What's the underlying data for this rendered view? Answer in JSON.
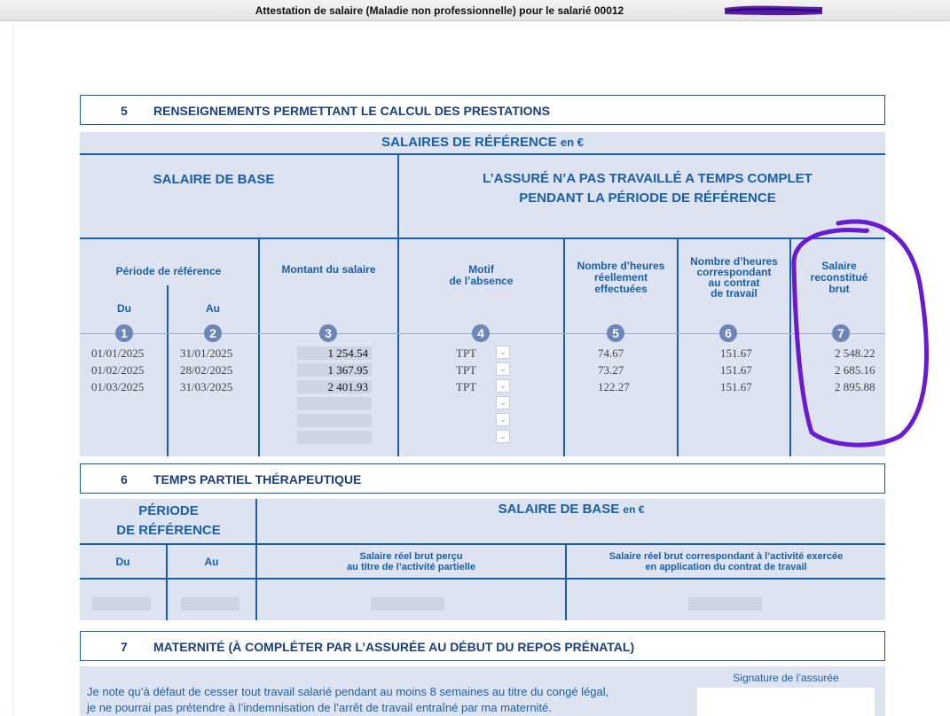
{
  "window": {
    "title": "Attestation de salaire (Maladie non professionnelle) pour le salarié 00012"
  },
  "section5": {
    "number": "5",
    "title": "RENSEIGNEMENTS PERMETTANT LE CALCUL DES PRESTATIONS",
    "ref_title": "SALAIRES DE RÉFÉRENCE",
    "ref_unit": "en €",
    "base_title": "SALAIRE DE BASE",
    "partial_title_1": "L’ASSURÉ N’A PAS TRAVAILLÉ A TEMPS COMPLET",
    "partial_title_2": "PENDANT LA PÉRIODE DE RÉFÉRENCE",
    "col_period": "Période de référence",
    "col_from": "Du",
    "col_to": "Au",
    "col_amount": "Montant du salaire",
    "col_reason_1": "Motif",
    "col_reason_2": "de l’absence",
    "col_hours_1": "Nombre d’heures",
    "col_hours_2": "réellement",
    "col_hours_3": "effectuées",
    "col_contract_1": "Nombre d’heures",
    "col_contract_2": "correspondant",
    "col_contract_3": "au contrat",
    "col_contract_4": "de travail",
    "col_recon_1": "Salaire",
    "col_recon_2": "reconstitué",
    "col_recon_3": "brut",
    "markers": [
      "1",
      "2",
      "3",
      "4",
      "5",
      "6",
      "7"
    ],
    "rows": [
      {
        "from": "01/01/2025",
        "to": "31/01/2025",
        "amount": "1 254.54",
        "reason": "TPT",
        "hours": "74.67",
        "contract": "151.67",
        "recon": "2 548.22"
      },
      {
        "from": "01/02/2025",
        "to": "28/02/2025",
        "amount": "1 367.95",
        "reason": "TPT",
        "hours": "73.27",
        "contract": "151.67",
        "recon": "2 685.16"
      },
      {
        "from": "01/03/2025",
        "to": "31/03/2025",
        "amount": "2 401.93",
        "reason": "TPT",
        "hours": "122.27",
        "contract": "151.67",
        "recon": "2 895.88"
      }
    ]
  },
  "section6": {
    "number": "6",
    "title": "TEMPS PARTIEL THÉRAPEUTIQUE",
    "period_1": "PÉRIODE",
    "period_2": "DE RÉFÉRENCE",
    "base_title": "SALAIRE DE BASE",
    "base_unit": "en €",
    "col_from": "Du",
    "col_to": "Au",
    "col_real_1": "Salaire réel brut perçu",
    "col_real_2": "au titre de l’activité partielle",
    "col_contract_1": "Salaire réel brut correspondant à l’activité exercée",
    "col_contract_2": "en application du contrat de travail"
  },
  "section7": {
    "number": "7",
    "title": "MATERNITÉ (À COMPLÉTER PAR L’ASSURÉE AU DÉBUT DU REPOS PRÉNATAL)",
    "text_1": "Je note qu’à défaut de cesser tout travail salarié pendant au moins 8 semaines au titre du congé légal,",
    "text_2": "je ne pourrai pas prétendre à l’indemnisation de l’arrêt de travail entraîné par ma maternité.",
    "signature_label": "Signature de l’assurée"
  },
  "colors": {
    "accent": "#1a5fa6",
    "panel": "#dde3f0",
    "annotation": "#6a1ad0"
  }
}
